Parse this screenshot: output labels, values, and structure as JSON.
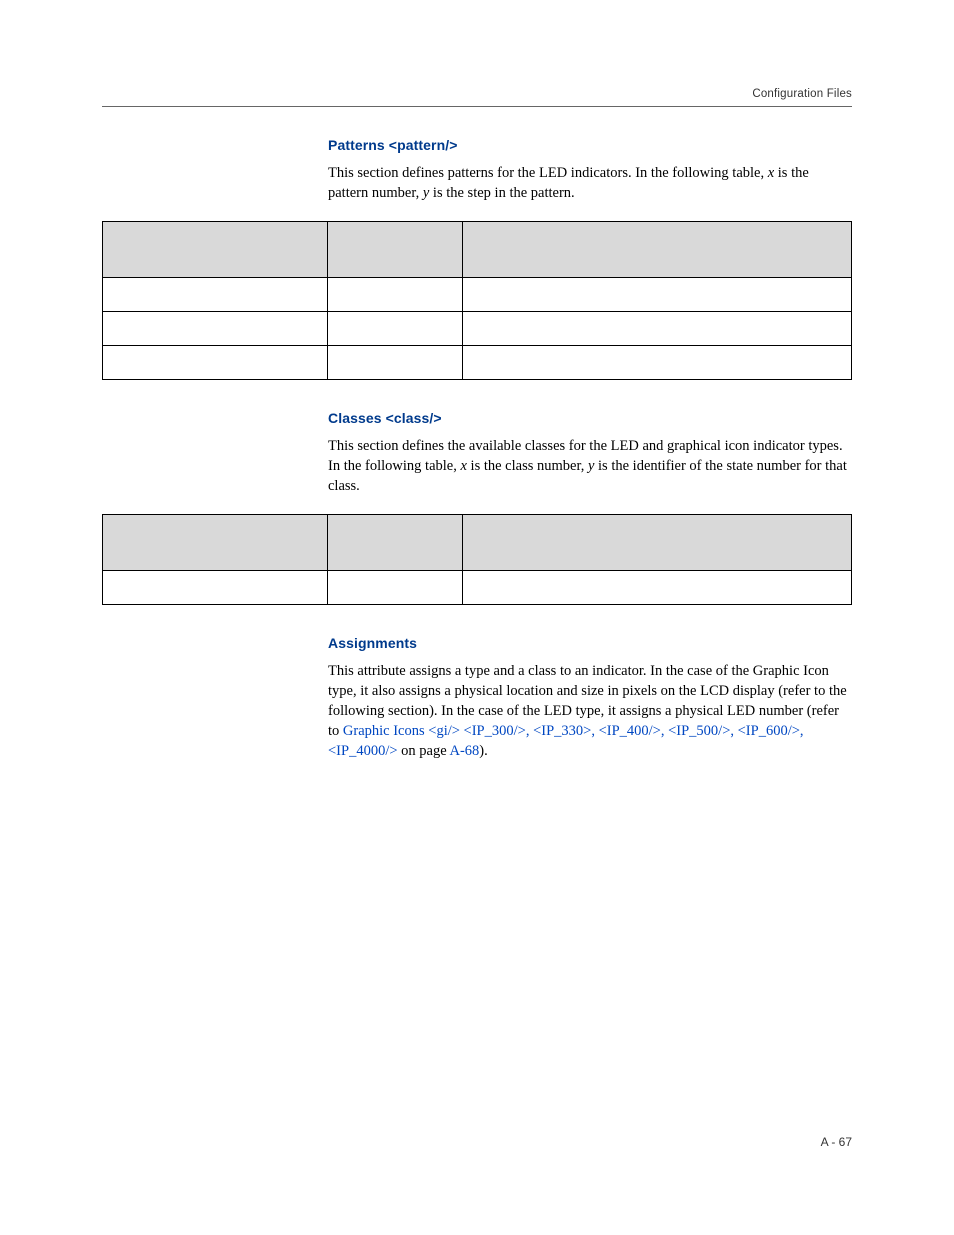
{
  "running_head": "Configuration Files",
  "sections": {
    "patterns": {
      "heading": "Patterns <pattern/>",
      "para_parts": {
        "p1a": "This section defines patterns for the LED indicators. In the following table, ",
        "x": "x",
        "p1b": " is the pattern number, ",
        "y": "y",
        "p1c": " is the step in the pattern."
      }
    },
    "classes": {
      "heading": "Classes <class/>",
      "para_parts": {
        "p1a": "This section defines the available classes for the LED and graphical icon indicator types. In the following table, ",
        "x": "x",
        "p1b": " is the class number, ",
        "y": "y",
        "p1c": " is the identifier of the state number for that class."
      }
    },
    "assignments": {
      "heading": "Assignments",
      "para_parts": {
        "p1a": "This attribute assigns a type and a class to an indicator. In the case of the Graphic Icon type, it also assigns a physical location and size in pixels on the LCD display (refer to the following section). In the case of the LED type, it assigns a physical LED number (refer to ",
        "link": "Graphic Icons <gi/> <IP_300/>, <IP_330>, <IP_400/>, <IP_500/>, <IP_600/>, <IP_4000/>",
        "p1b": " on page ",
        "pageref": "A-68",
        "p1c": ")."
      }
    }
  },
  "table1": {
    "headers": [
      "",
      "",
      ""
    ],
    "rows": [
      [
        "",
        "",
        ""
      ],
      [
        "",
        "",
        ""
      ],
      [
        "",
        "",
        ""
      ]
    ]
  },
  "table2": {
    "headers": [
      "",
      "",
      ""
    ],
    "rows": [
      [
        "",
        "",
        ""
      ]
    ]
  },
  "page_number": "A - 67"
}
